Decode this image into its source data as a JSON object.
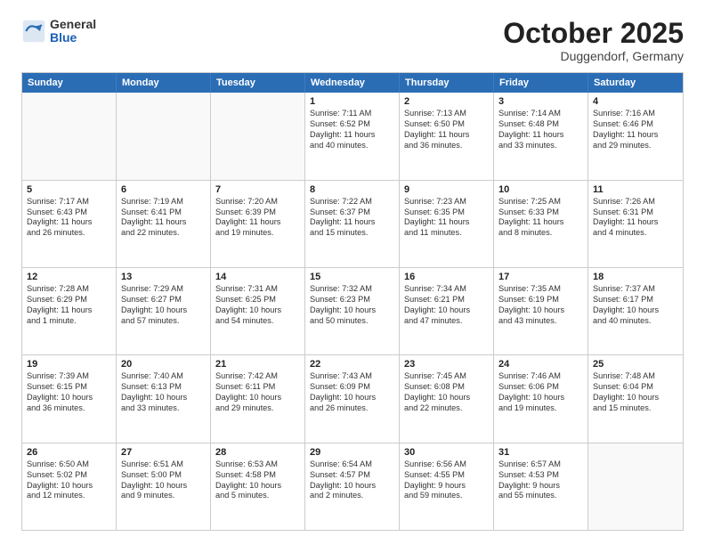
{
  "logo": {
    "general": "General",
    "blue": "Blue"
  },
  "header": {
    "month": "October 2025",
    "location": "Duggendorf, Germany"
  },
  "weekdays": [
    "Sunday",
    "Monday",
    "Tuesday",
    "Wednesday",
    "Thursday",
    "Friday",
    "Saturday"
  ],
  "rows": [
    [
      {
        "day": "",
        "lines": [],
        "empty": true
      },
      {
        "day": "",
        "lines": [],
        "empty": true
      },
      {
        "day": "",
        "lines": [],
        "empty": true
      },
      {
        "day": "1",
        "lines": [
          "Sunrise: 7:11 AM",
          "Sunset: 6:52 PM",
          "Daylight: 11 hours",
          "and 40 minutes."
        ]
      },
      {
        "day": "2",
        "lines": [
          "Sunrise: 7:13 AM",
          "Sunset: 6:50 PM",
          "Daylight: 11 hours",
          "and 36 minutes."
        ]
      },
      {
        "day": "3",
        "lines": [
          "Sunrise: 7:14 AM",
          "Sunset: 6:48 PM",
          "Daylight: 11 hours",
          "and 33 minutes."
        ]
      },
      {
        "day": "4",
        "lines": [
          "Sunrise: 7:16 AM",
          "Sunset: 6:46 PM",
          "Daylight: 11 hours",
          "and 29 minutes."
        ]
      }
    ],
    [
      {
        "day": "5",
        "lines": [
          "Sunrise: 7:17 AM",
          "Sunset: 6:43 PM",
          "Daylight: 11 hours",
          "and 26 minutes."
        ]
      },
      {
        "day": "6",
        "lines": [
          "Sunrise: 7:19 AM",
          "Sunset: 6:41 PM",
          "Daylight: 11 hours",
          "and 22 minutes."
        ]
      },
      {
        "day": "7",
        "lines": [
          "Sunrise: 7:20 AM",
          "Sunset: 6:39 PM",
          "Daylight: 11 hours",
          "and 19 minutes."
        ]
      },
      {
        "day": "8",
        "lines": [
          "Sunrise: 7:22 AM",
          "Sunset: 6:37 PM",
          "Daylight: 11 hours",
          "and 15 minutes."
        ]
      },
      {
        "day": "9",
        "lines": [
          "Sunrise: 7:23 AM",
          "Sunset: 6:35 PM",
          "Daylight: 11 hours",
          "and 11 minutes."
        ]
      },
      {
        "day": "10",
        "lines": [
          "Sunrise: 7:25 AM",
          "Sunset: 6:33 PM",
          "Daylight: 11 hours",
          "and 8 minutes."
        ]
      },
      {
        "day": "11",
        "lines": [
          "Sunrise: 7:26 AM",
          "Sunset: 6:31 PM",
          "Daylight: 11 hours",
          "and 4 minutes."
        ]
      }
    ],
    [
      {
        "day": "12",
        "lines": [
          "Sunrise: 7:28 AM",
          "Sunset: 6:29 PM",
          "Daylight: 11 hours",
          "and 1 minute."
        ]
      },
      {
        "day": "13",
        "lines": [
          "Sunrise: 7:29 AM",
          "Sunset: 6:27 PM",
          "Daylight: 10 hours",
          "and 57 minutes."
        ]
      },
      {
        "day": "14",
        "lines": [
          "Sunrise: 7:31 AM",
          "Sunset: 6:25 PM",
          "Daylight: 10 hours",
          "and 54 minutes."
        ]
      },
      {
        "day": "15",
        "lines": [
          "Sunrise: 7:32 AM",
          "Sunset: 6:23 PM",
          "Daylight: 10 hours",
          "and 50 minutes."
        ]
      },
      {
        "day": "16",
        "lines": [
          "Sunrise: 7:34 AM",
          "Sunset: 6:21 PM",
          "Daylight: 10 hours",
          "and 47 minutes."
        ]
      },
      {
        "day": "17",
        "lines": [
          "Sunrise: 7:35 AM",
          "Sunset: 6:19 PM",
          "Daylight: 10 hours",
          "and 43 minutes."
        ]
      },
      {
        "day": "18",
        "lines": [
          "Sunrise: 7:37 AM",
          "Sunset: 6:17 PM",
          "Daylight: 10 hours",
          "and 40 minutes."
        ]
      }
    ],
    [
      {
        "day": "19",
        "lines": [
          "Sunrise: 7:39 AM",
          "Sunset: 6:15 PM",
          "Daylight: 10 hours",
          "and 36 minutes."
        ]
      },
      {
        "day": "20",
        "lines": [
          "Sunrise: 7:40 AM",
          "Sunset: 6:13 PM",
          "Daylight: 10 hours",
          "and 33 minutes."
        ]
      },
      {
        "day": "21",
        "lines": [
          "Sunrise: 7:42 AM",
          "Sunset: 6:11 PM",
          "Daylight: 10 hours",
          "and 29 minutes."
        ]
      },
      {
        "day": "22",
        "lines": [
          "Sunrise: 7:43 AM",
          "Sunset: 6:09 PM",
          "Daylight: 10 hours",
          "and 26 minutes."
        ]
      },
      {
        "day": "23",
        "lines": [
          "Sunrise: 7:45 AM",
          "Sunset: 6:08 PM",
          "Daylight: 10 hours",
          "and 22 minutes."
        ]
      },
      {
        "day": "24",
        "lines": [
          "Sunrise: 7:46 AM",
          "Sunset: 6:06 PM",
          "Daylight: 10 hours",
          "and 19 minutes."
        ]
      },
      {
        "day": "25",
        "lines": [
          "Sunrise: 7:48 AM",
          "Sunset: 6:04 PM",
          "Daylight: 10 hours",
          "and 15 minutes."
        ]
      }
    ],
    [
      {
        "day": "26",
        "lines": [
          "Sunrise: 6:50 AM",
          "Sunset: 5:02 PM",
          "Daylight: 10 hours",
          "and 12 minutes."
        ]
      },
      {
        "day": "27",
        "lines": [
          "Sunrise: 6:51 AM",
          "Sunset: 5:00 PM",
          "Daylight: 10 hours",
          "and 9 minutes."
        ]
      },
      {
        "day": "28",
        "lines": [
          "Sunrise: 6:53 AM",
          "Sunset: 4:58 PM",
          "Daylight: 10 hours",
          "and 5 minutes."
        ]
      },
      {
        "day": "29",
        "lines": [
          "Sunrise: 6:54 AM",
          "Sunset: 4:57 PM",
          "Daylight: 10 hours",
          "and 2 minutes."
        ]
      },
      {
        "day": "30",
        "lines": [
          "Sunrise: 6:56 AM",
          "Sunset: 4:55 PM",
          "Daylight: 9 hours",
          "and 59 minutes."
        ]
      },
      {
        "day": "31",
        "lines": [
          "Sunrise: 6:57 AM",
          "Sunset: 4:53 PM",
          "Daylight: 9 hours",
          "and 55 minutes."
        ]
      },
      {
        "day": "",
        "lines": [],
        "empty": true
      }
    ]
  ]
}
